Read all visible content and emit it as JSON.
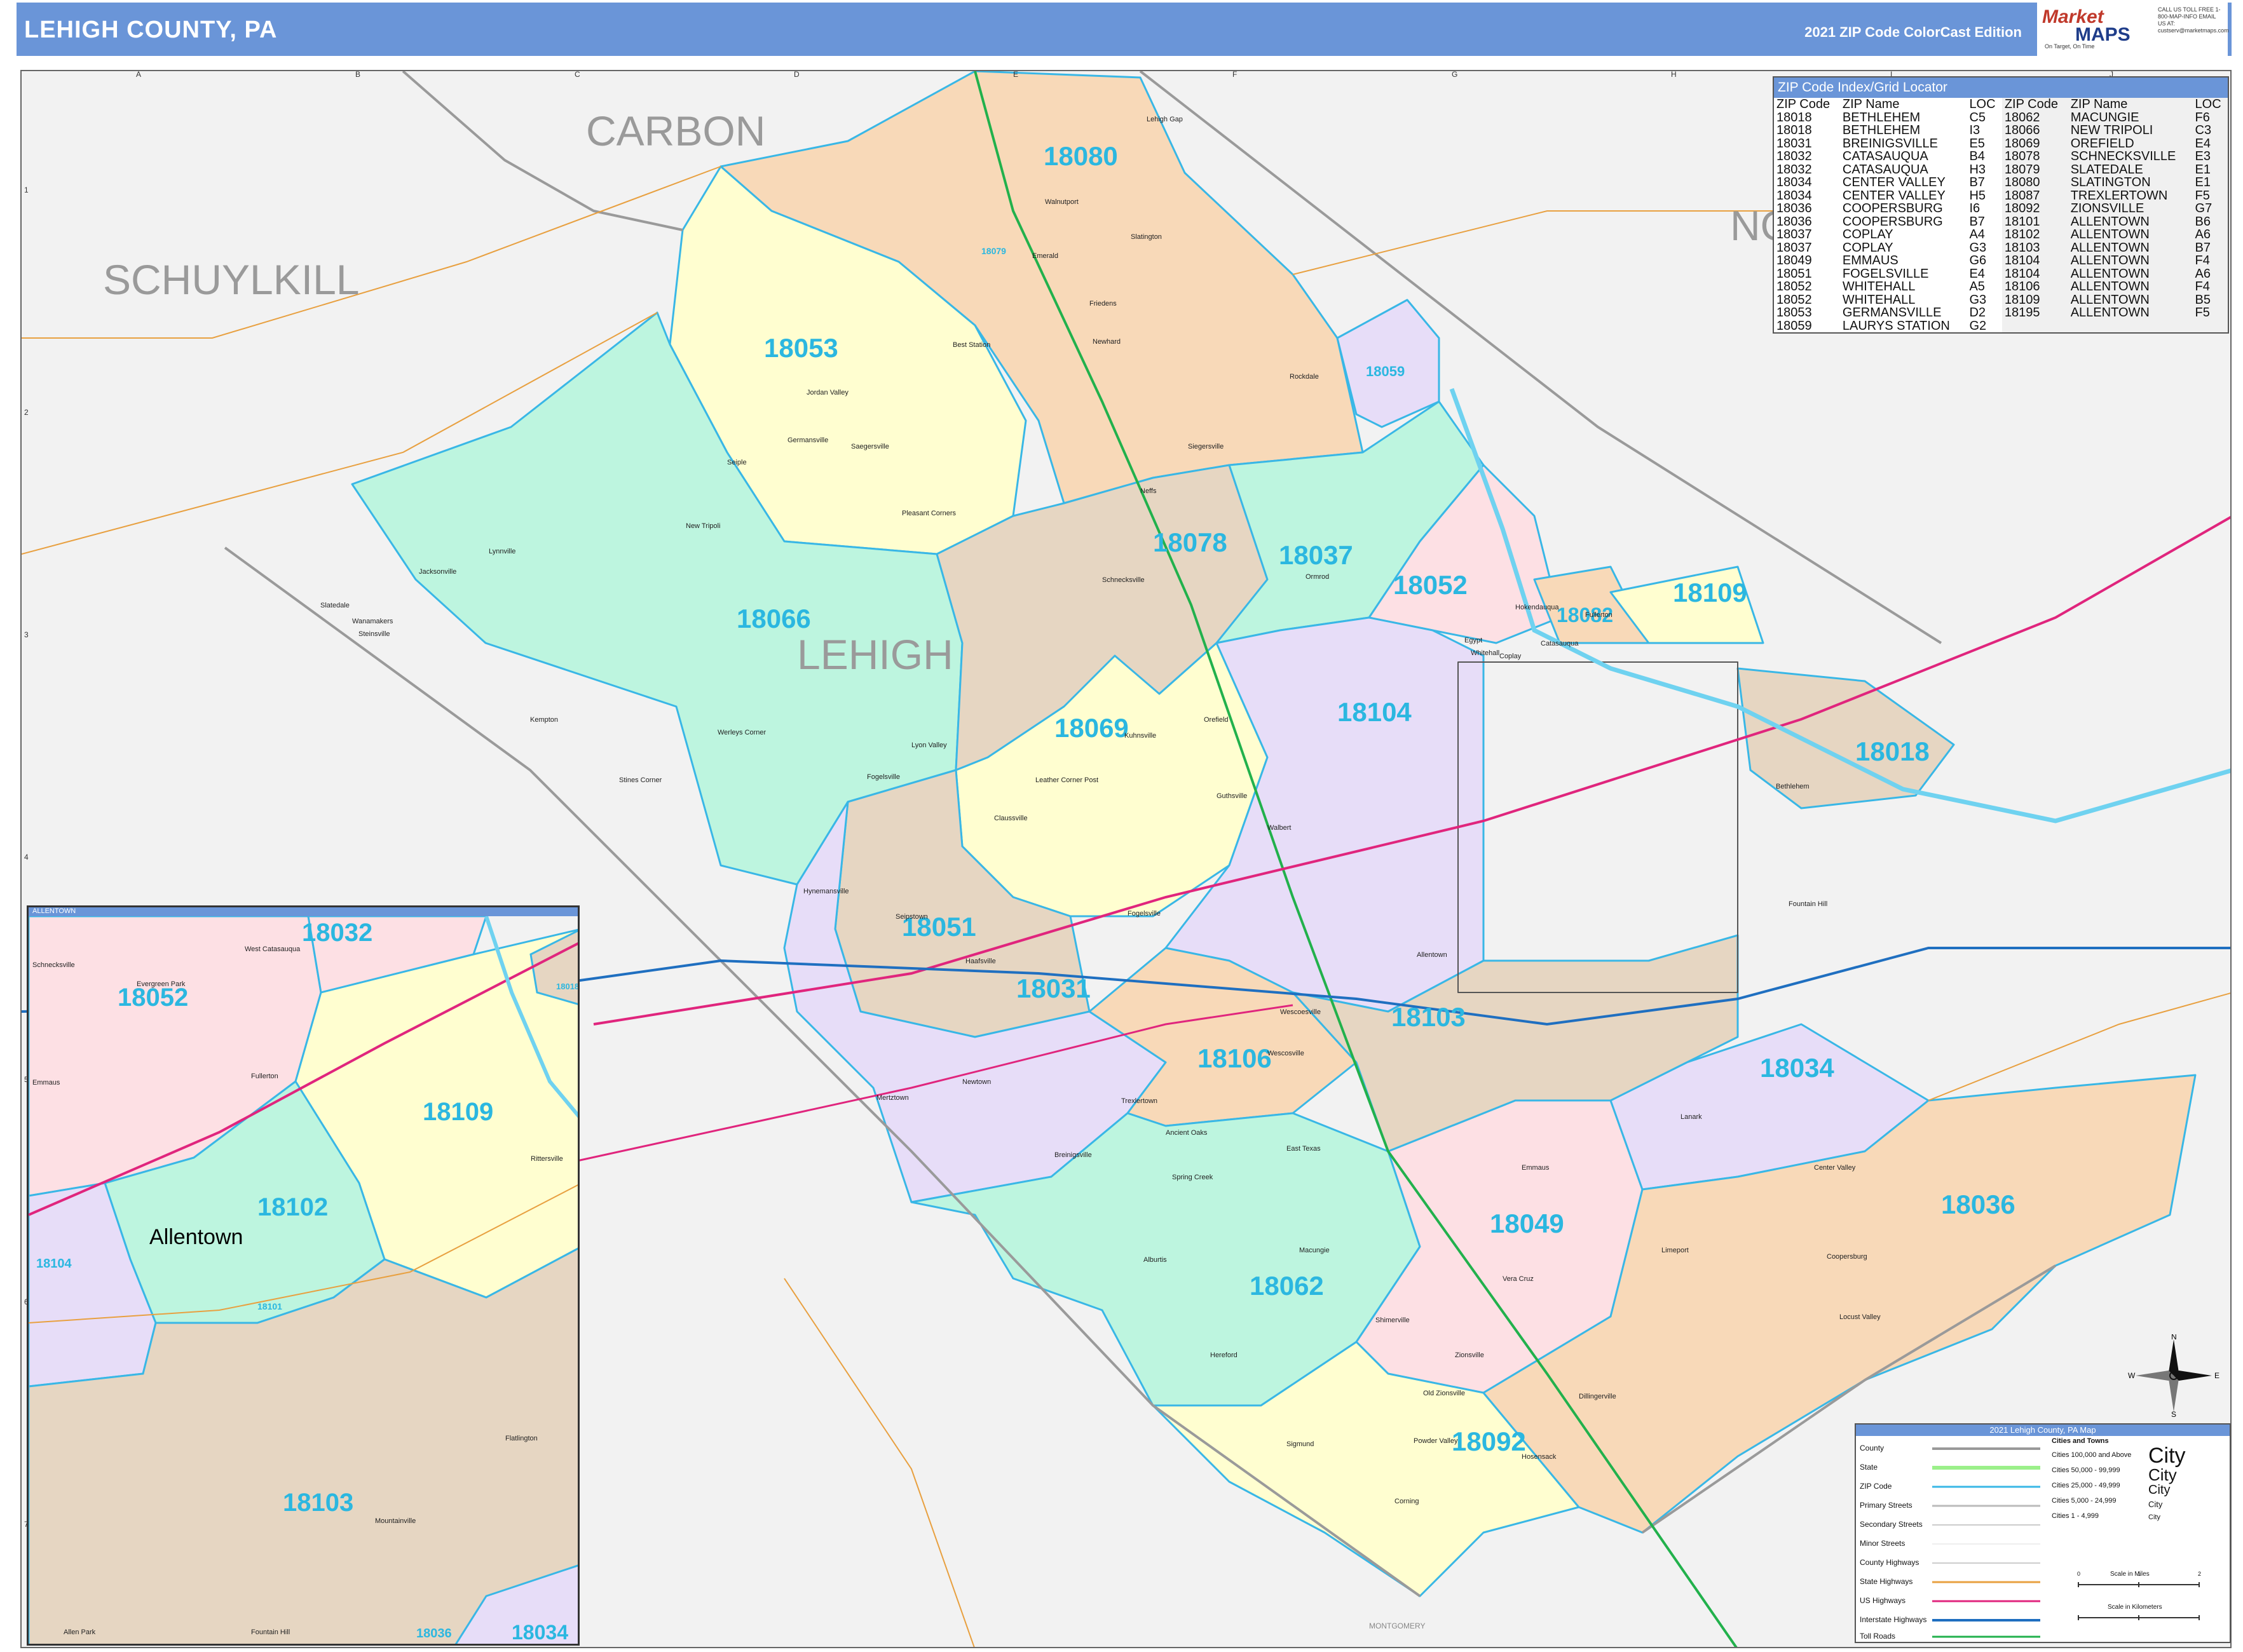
{
  "header": {
    "title": "LEHIGH COUNTY, PA",
    "edition": "2021 ZIP Code ColorCast Edition",
    "logo_top": "Market",
    "logo_bottom": "MAPS",
    "logo_tagline": "On Target, On Time",
    "logo_contact": "CALL US TOLL FREE 1-800-MAP-INFO EMAIL US AT: custserv@marketmaps.com"
  },
  "colors": {
    "header": "#6a95d8",
    "zip_label": "#2bb7e0",
    "zip_boundary": "#39b7e6",
    "river": "#6fd2f0",
    "us_highway": "#e0257d",
    "interstate": "#1f6fc0",
    "state_line": "#22b14c",
    "state_road": "#e8a040",
    "county_line": "#9a9a9a"
  },
  "counties": [
    "CARBON",
    "SCHUYLKILL",
    "LEHIGH",
    "NO",
    "MONTGOMERY"
  ],
  "grid_columns": [
    "A",
    "B",
    "C",
    "D",
    "E",
    "F",
    "G",
    "H",
    "I",
    "J"
  ],
  "grid_rows": [
    "1",
    "2",
    "3",
    "4",
    "5",
    "6",
    "7"
  ],
  "zips_main": [
    "18080",
    "18053",
    "18059",
    "18078",
    "18037",
    "18052",
    "18082",
    "18109",
    "18066",
    "18069",
    "18104",
    "18018",
    "18051",
    "18031",
    "18103",
    "18106",
    "18034",
    "18036",
    "18049",
    "18062",
    "18092",
    "18079"
  ],
  "towns": [
    "Lehigh Gap",
    "Slatington",
    "Walnutport",
    "Emerald",
    "Friedens",
    "Newhard",
    "Best Station",
    "Rockdale",
    "Jordan Valley",
    "Germansville",
    "Seiple",
    "Saegersville",
    "Neffs",
    "Siegersville",
    "Pleasant Corners",
    "Schnecksville",
    "New Tripoli",
    "Lynnville",
    "Jacksonville",
    "Slatedale",
    "Wanamakers",
    "Steinsville",
    "Claussville",
    "Orefield",
    "Coplay",
    "Egypt",
    "Hokendauqua",
    "Catasauqua",
    "Whitehall",
    "Ormrod",
    "Fullerton",
    "Fogelsville",
    "Breinigsville",
    "Trexlertown",
    "Wescosville",
    "Macungie",
    "Alburtis",
    "Emmaus",
    "Coopersburg",
    "Zionsville",
    "Old Zionsville",
    "Center Valley",
    "Limeport",
    "Vera Cruz",
    "Dillingerville",
    "Powder Valley",
    "Hosensack",
    "Corning",
    "Sigmund",
    "Hereford",
    "Spring Creek",
    "Ancient Oaks",
    "East Texas",
    "Shimerville",
    "Lanark",
    "Locust Valley",
    "Allentown",
    "Bethlehem",
    "Kempton",
    "Stines Corner",
    "Werleys Corner",
    "Lyon Valley",
    "Leather Corner Post",
    "Kuhnsville",
    "Guthsville",
    "Walbert",
    "Hynemansville",
    "Seipstown",
    "Haafsville",
    "Fogelsville",
    "Mertztown",
    "Newtown",
    "Wescoesville",
    "Fountain Hill"
  ],
  "zip_index": {
    "title": "ZIP Code Index/Grid Locator",
    "headers": [
      "ZIP Code",
      "ZIP Name",
      "LOC",
      "ZIP Code",
      "ZIP Name",
      "LOC"
    ],
    "left": [
      [
        "18018",
        "BETHLEHEM",
        "C5"
      ],
      [
        "18018",
        "BETHLEHEM",
        "I3"
      ],
      [
        "18031",
        "BREINIGSVILLE",
        "E5"
      ],
      [
        "18032",
        "CATASAUQUA",
        "B4"
      ],
      [
        "18032",
        "CATASAUQUA",
        "H3"
      ],
      [
        "18034",
        "CENTER VALLEY",
        "B7"
      ],
      [
        "18034",
        "CENTER VALLEY",
        "H5"
      ],
      [
        "18036",
        "COOPERSBURG",
        "I6"
      ],
      [
        "18036",
        "COOPERSBURG",
        "B7"
      ],
      [
        "18037",
        "COPLAY",
        "A4"
      ],
      [
        "18037",
        "COPLAY",
        "G3"
      ],
      [
        "18049",
        "EMMAUS",
        "G6"
      ],
      [
        "18051",
        "FOGELSVILLE",
        "E4"
      ],
      [
        "18052",
        "WHITEHALL",
        "A5"
      ],
      [
        "18052",
        "WHITEHALL",
        "G3"
      ],
      [
        "18053",
        "GERMANSVILLE",
        "D2"
      ],
      [
        "18059",
        "LAURYS STATION",
        "G2"
      ]
    ],
    "right": [
      [
        "18062",
        "MACUNGIE",
        "F6"
      ],
      [
        "18066",
        "NEW TRIPOLI",
        "C3"
      ],
      [
        "18069",
        "OREFIELD",
        "E4"
      ],
      [
        "18078",
        "SCHNECKSVILLE",
        "E3"
      ],
      [
        "18079",
        "SLATEDALE",
        "E1"
      ],
      [
        "18080",
        "SLATINGTON",
        "E1"
      ],
      [
        "18087",
        "TREXLERTOWN",
        "F5"
      ],
      [
        "18092",
        "ZIONSVILLE",
        "G7"
      ],
      [
        "18101",
        "ALLENTOWN",
        "B6"
      ],
      [
        "18102",
        "ALLENTOWN",
        "A6"
      ],
      [
        "18103",
        "ALLENTOWN",
        "B7"
      ],
      [
        "18104",
        "ALLENTOWN",
        "F4"
      ],
      [
        "18104",
        "ALLENTOWN",
        "A6"
      ],
      [
        "18106",
        "ALLENTOWN",
        "F4"
      ],
      [
        "18109",
        "ALLENTOWN",
        "B5"
      ],
      [
        "18195",
        "ALLENTOWN",
        "F5"
      ]
    ]
  },
  "inset": {
    "title": "ALLENTOWN",
    "city": "Allentown",
    "zips": [
      "18032",
      "18052",
      "18109",
      "18102",
      "18103",
      "18104",
      "18101",
      "18036",
      "18034",
      "18018"
    ],
    "towns": [
      "West Catasauqua",
      "Evergreen Park",
      "Fullerton",
      "Mountainville",
      "Emmaus",
      "Allen Park",
      "Rittersville",
      "Fountain Hill",
      "Flatlington",
      "Schnecksville"
    ]
  },
  "legend": {
    "title": "2021 Lehigh County, PA Map",
    "items": [
      "County",
      "State",
      "ZIP Code",
      "Primary Streets",
      "Secondary Streets",
      "Minor Streets",
      "County Highways",
      "State Highways",
      "US Highways",
      "Interstate Highways",
      "Toll Roads"
    ],
    "city_title": "Cities and Towns",
    "city_classes": [
      "Cities 100,000 and Above",
      "Cities 50,000 - 99,999",
      "Cities 25,000 - 49,999",
      "Cities 5,000 - 24,999",
      "Cities 1 - 4,999"
    ],
    "city_sample": "City",
    "scale_miles": "Scale in Miles",
    "scale_km": "Scale in Kilometers",
    "scale_ticks": [
      "0",
      "1",
      "2"
    ]
  },
  "compass": {
    "n": "N",
    "s": "S",
    "e": "E",
    "w": "W"
  }
}
